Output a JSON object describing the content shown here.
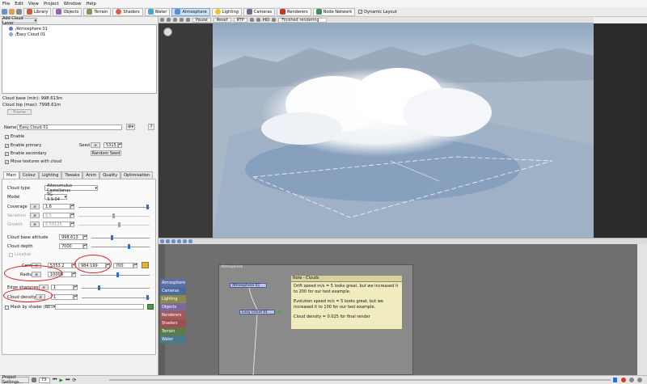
{
  "menu": [
    "File",
    "Edit",
    "View",
    "Project",
    "Window",
    "Help"
  ],
  "toolbar": {
    "library": "Library",
    "objects": "Objects",
    "terrain": "Terrain",
    "shaders": "Shaders",
    "water": "Water",
    "atmosphere": "Atmosphere",
    "lighting": "Lighting",
    "cameras": "Cameras",
    "renderers": "Renderers",
    "node_network": "Node Network",
    "dynamic_layout": "Dynamic Layout"
  },
  "layers": {
    "add_button": "Add Cloud Layer",
    "items": [
      "/Atmosphere 01",
      "/Easy Cloud 01"
    ],
    "cloud_base": "Cloud base (min): 998.613m",
    "cloud_top": "Cloud top (max): 7998.61m",
    "frame_button": "Frame"
  },
  "props": {
    "name_label": "Name",
    "name_value": "Easy Cloud 01",
    "enable": "Enable",
    "enable_primary": "Enable primary",
    "enable_secondary": "Enable secondary",
    "move_textures": "Move textures with cloud",
    "seed_label": "Seed",
    "seed_value": "5315",
    "random_seed": "Random Seed"
  },
  "tabs": [
    "Main",
    "Colour",
    "Lighting",
    "Tweaks",
    "Anim",
    "Quality",
    "Optimisation"
  ],
  "main": {
    "cloud_type_label": "Cloud type",
    "cloud_type_value": "Altocumulus Castellanus",
    "model_label": "Model",
    "model_value": "TG 3.9.04",
    "coverage_label": "Coverage",
    "coverage_value": "1.6",
    "variation_label": "Variation",
    "variation_value": "0.5",
    "growth_label": "Growth",
    "growth_value": "0.58125",
    "base_alt_label": "Cloud base altitude",
    "base_alt_value": "998.613",
    "depth_label": "Cloud depth",
    "depth_value": "7000",
    "localise": "Localise",
    "centre_label": "Centre",
    "centre_x": "5353.2",
    "centre_y": "984.199",
    "centre_z": "700",
    "radius_label": "Radius",
    "radius_value": "10000",
    "edge_label": "Edge sharpness",
    "edge_value": "1",
    "density_label": "Cloud density",
    "density_value": "1",
    "mask_label": "Mask by shader (BETA)"
  },
  "viewport": {
    "pause": "Pause",
    "reset": "Reset",
    "rtp": "RTP",
    "hd": "HD",
    "status": "Finished rendering"
  },
  "network": {
    "atmosphere_group": "Atmosphere",
    "node_atmos": "Atmosphere 01",
    "node_cloud": "Easy Cloud 01",
    "categories": [
      "Atmosphere",
      "Cameras",
      "Lighting",
      "Objects",
      "Renderers",
      "Shaders",
      "Terrain",
      "Water"
    ],
    "note_title": "Note - Clouds",
    "note_lines": [
      "Drift speed m/s = 5 looks great, but we increased it to 200 for our test example.",
      "Evolution speed m/s = 5 looks great, but we increased it to 100 for our test example.",
      "Cloud density = 0.025 for final render"
    ]
  },
  "status": {
    "project_settings": "Project Settings...",
    "frame": "73"
  },
  "colors": {
    "accent": "#2a6fd1",
    "highlight": "#e21a1a",
    "note_bg": "#f1ecc0"
  }
}
